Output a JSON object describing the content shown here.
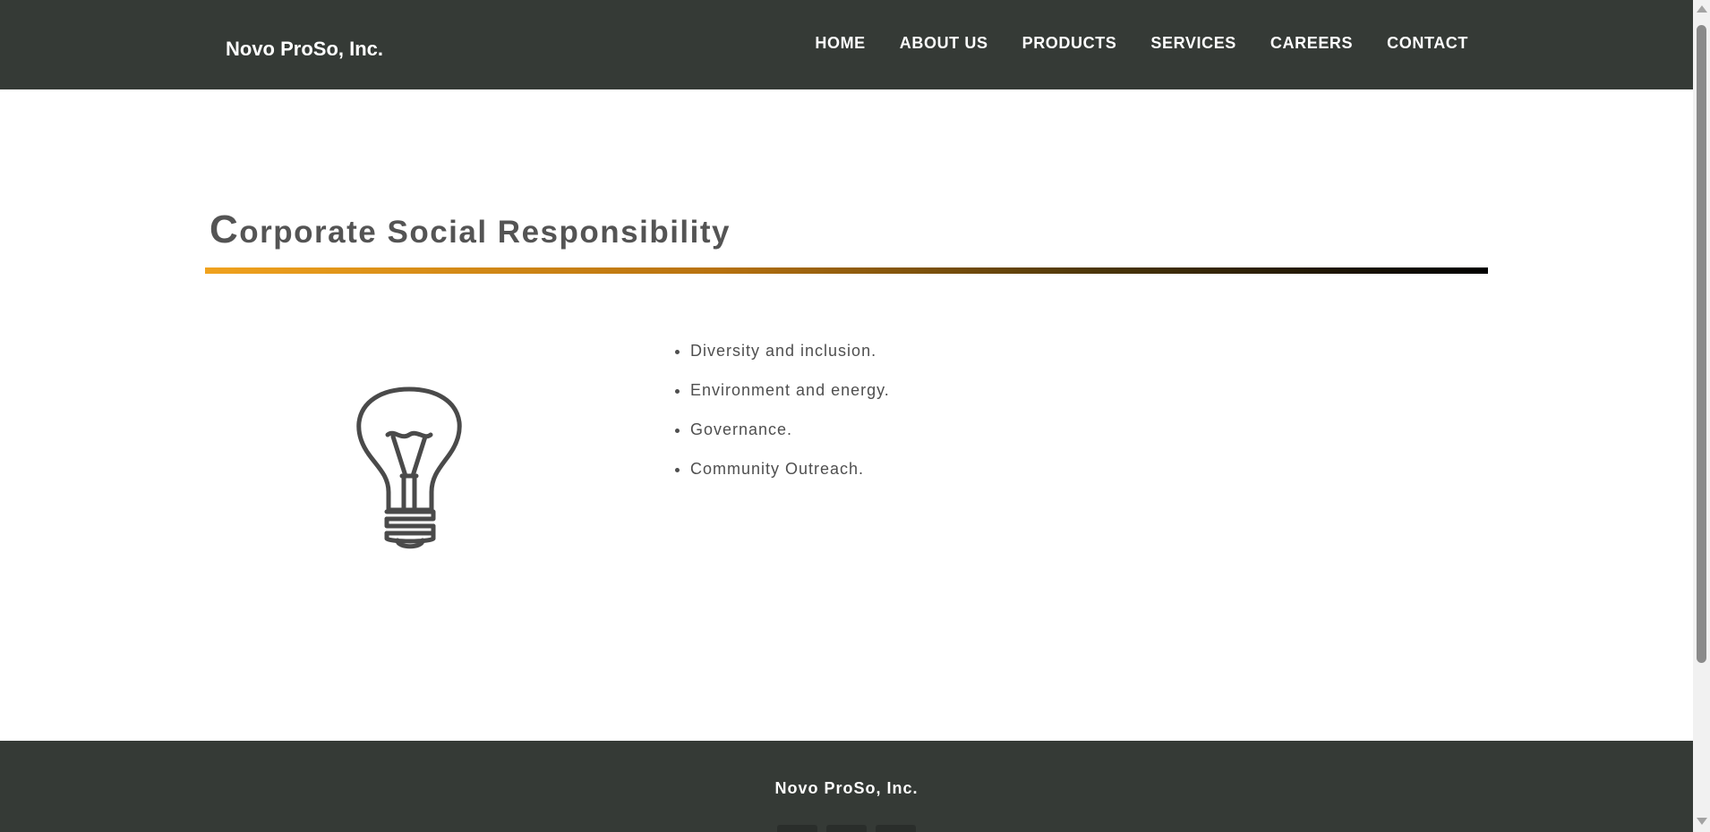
{
  "header": {
    "brand": "Novo ProSo, Inc.",
    "nav": [
      {
        "label": "HOME"
      },
      {
        "label": "ABOUT US"
      },
      {
        "label": "PRODUCTS"
      },
      {
        "label": "SERVICES"
      },
      {
        "label": "CAREERS"
      },
      {
        "label": "CONTACT"
      }
    ]
  },
  "main": {
    "title": "Corporate Social Responsibility",
    "illustration_icon": "lightbulb-icon",
    "items": [
      {
        "text": "Diversity and inclusion."
      },
      {
        "text": "Environment and energy."
      },
      {
        "text": "Governance."
      },
      {
        "text": "Community Outreach."
      }
    ]
  },
  "footer": {
    "brand": "Novo ProSo, Inc."
  },
  "colors": {
    "header_bg": "#353a36",
    "footer_bg": "#353a36",
    "title_text": "#545454",
    "rule_start": "#f0a21e",
    "rule_end": "#000000"
  }
}
